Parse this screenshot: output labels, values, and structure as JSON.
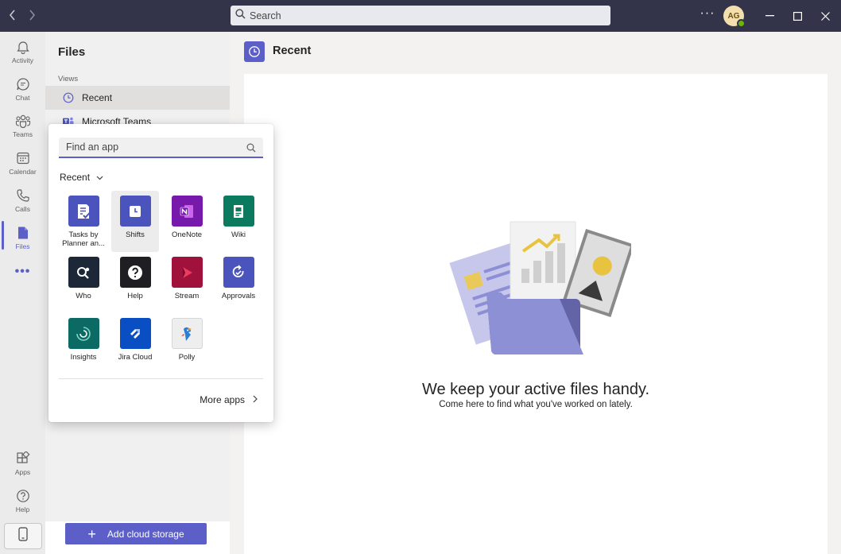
{
  "titlebar": {
    "search_label": "Search",
    "more_label": "···",
    "avatar_initials": "AG"
  },
  "rail": {
    "items": [
      {
        "label": "Activity",
        "icon": "bell-icon"
      },
      {
        "label": "Chat",
        "icon": "chat-icon"
      },
      {
        "label": "Teams",
        "icon": "teams-icon"
      },
      {
        "label": "Calendar",
        "icon": "calendar-icon"
      },
      {
        "label": "Calls",
        "icon": "phone-icon"
      },
      {
        "label": "Files",
        "icon": "file-icon"
      }
    ],
    "more_label": "•••",
    "bottom_items": [
      {
        "label": "Apps",
        "icon": "apps-icon"
      },
      {
        "label": "Help",
        "icon": "help-icon"
      }
    ]
  },
  "files_panel": {
    "title": "Files",
    "views_label": "Views",
    "views": [
      {
        "label": "Recent",
        "icon": "clock-icon",
        "selected": true
      },
      {
        "label": "Microsoft Teams",
        "icon": "teams-logo-icon",
        "selected": false
      }
    ],
    "add_cloud_label": "Add cloud storage"
  },
  "main": {
    "title": "Recent",
    "empty_title": "We keep your active files handy.",
    "empty_subtitle": "Come here to find what you've worked on lately."
  },
  "app_popup": {
    "search_placeholder": "Find an app",
    "section_label": "Recent",
    "more_apps_label": "More apps",
    "apps": [
      {
        "label": "Tasks by Planner an...",
        "color": "#4b53bc"
      },
      {
        "label": "Shifts",
        "color": "#4b53bc"
      },
      {
        "label": "OneNote",
        "color": "#7719aa"
      },
      {
        "label": "Wiki",
        "color": "#0b7a5e"
      },
      {
        "label": "Who",
        "color": "#1c2838"
      },
      {
        "label": "Help",
        "color": "#1f1f23"
      },
      {
        "label": "Stream",
        "color": "#a0113c"
      },
      {
        "label": "Approvals",
        "color": "#4b53bc"
      },
      {
        "label": "Insights",
        "color": "#0b6a63"
      },
      {
        "label": "Jira Cloud",
        "color": "#0a4ec4"
      },
      {
        "label": "Polly",
        "color": "#eeeeee"
      }
    ]
  },
  "colors": {
    "brand": "#5b5fc7",
    "titlebar": "#33344a",
    "presence_available": "#6bb700"
  }
}
